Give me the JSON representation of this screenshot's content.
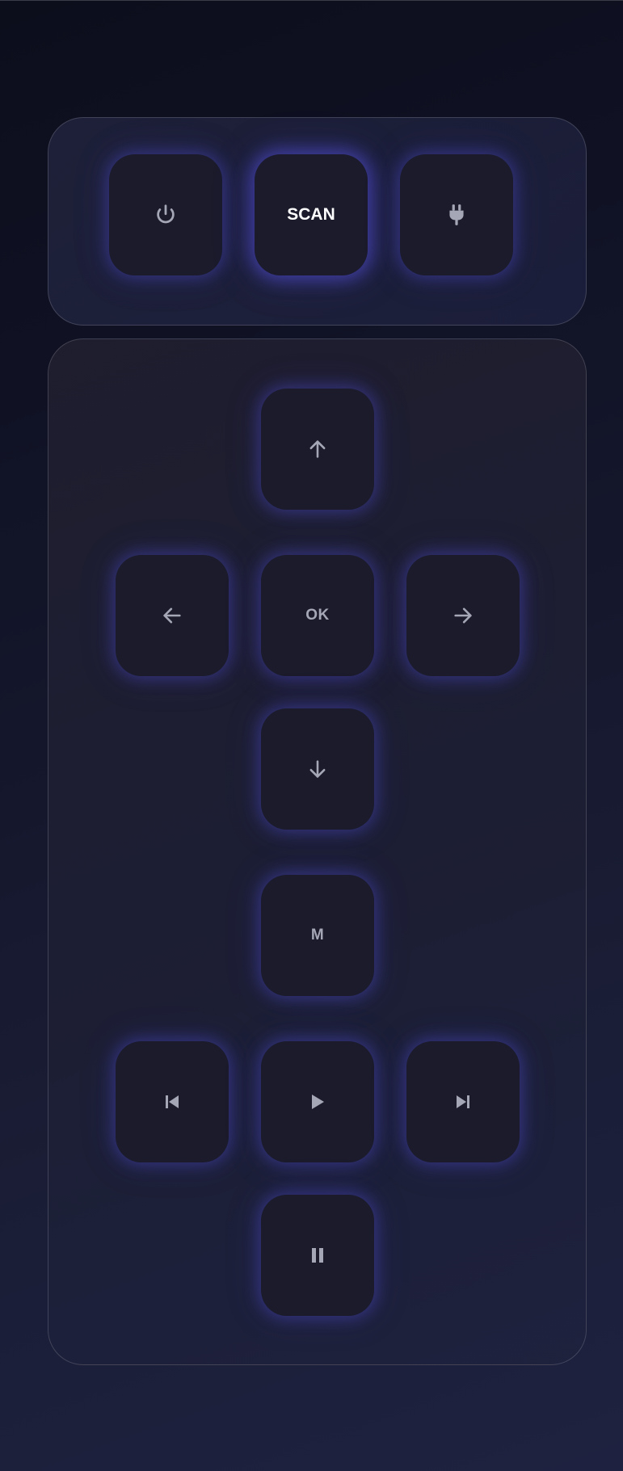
{
  "top_controls": {
    "power_icon": "power-icon",
    "scan_label": "SCAN",
    "plug_icon": "plug-icon"
  },
  "navigation": {
    "up_icon": "arrow-up-icon",
    "left_icon": "arrow-left-icon",
    "ok_label": "OK",
    "right_icon": "arrow-right-icon",
    "down_icon": "arrow-down-icon"
  },
  "menu": {
    "label": "M"
  },
  "media": {
    "previous_icon": "skip-previous-icon",
    "play_icon": "play-icon",
    "next_icon": "skip-next-icon",
    "pause_icon": "pause-icon"
  },
  "colors": {
    "background": "#121428",
    "button": "#1b1b2c",
    "glow": "#4a46be",
    "icon": "#a6a7b6",
    "scan_text": "#ffffff"
  }
}
